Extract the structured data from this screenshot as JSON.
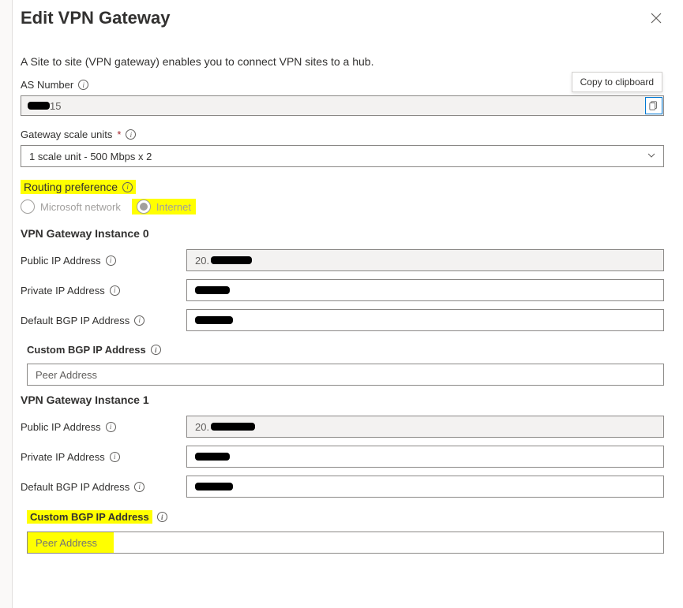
{
  "header": {
    "title": "Edit VPN Gateway",
    "tooltip": "Copy to clipboard"
  },
  "description": "A Site to site (VPN gateway) enables you to connect VPN sites to a hub.",
  "as_number": {
    "label": "AS Number",
    "value_prefix": "",
    "value_suffix": "15"
  },
  "gateway_scale": {
    "label": "Gateway scale units",
    "required": "*",
    "value": "1 scale unit - 500 Mbps x 2"
  },
  "routing": {
    "label": "Routing preference",
    "opt_ms": "Microsoft network",
    "opt_internet": "Internet"
  },
  "instance0": {
    "heading": "VPN Gateway Instance 0",
    "public_ip_label": "Public IP Address",
    "public_ip_prefix": "20.",
    "private_ip_label": "Private IP Address",
    "default_bgp_label": "Default BGP IP Address",
    "custom_bgp_heading": "Custom BGP IP Address",
    "peer_placeholder": "Peer Address"
  },
  "instance1": {
    "heading": "VPN Gateway Instance 1",
    "public_ip_label": "Public IP Address",
    "public_ip_prefix": "20.",
    "private_ip_label": "Private IP Address",
    "default_bgp_label": "Default BGP IP Address",
    "custom_bgp_heading": "Custom BGP IP Address",
    "peer_placeholder": "Peer Address"
  }
}
